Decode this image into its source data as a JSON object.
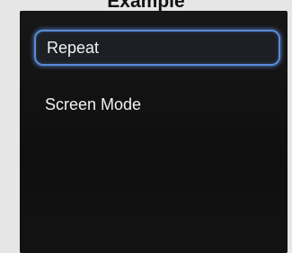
{
  "caption": "Example",
  "menu": {
    "items": [
      {
        "label": "Repeat",
        "selected": true
      },
      {
        "label": "Screen Mode",
        "selected": false
      }
    ]
  },
  "colors": {
    "focus_border": "#5a8ad6",
    "panel_background": "#111111",
    "text": "#f2f2f2"
  }
}
